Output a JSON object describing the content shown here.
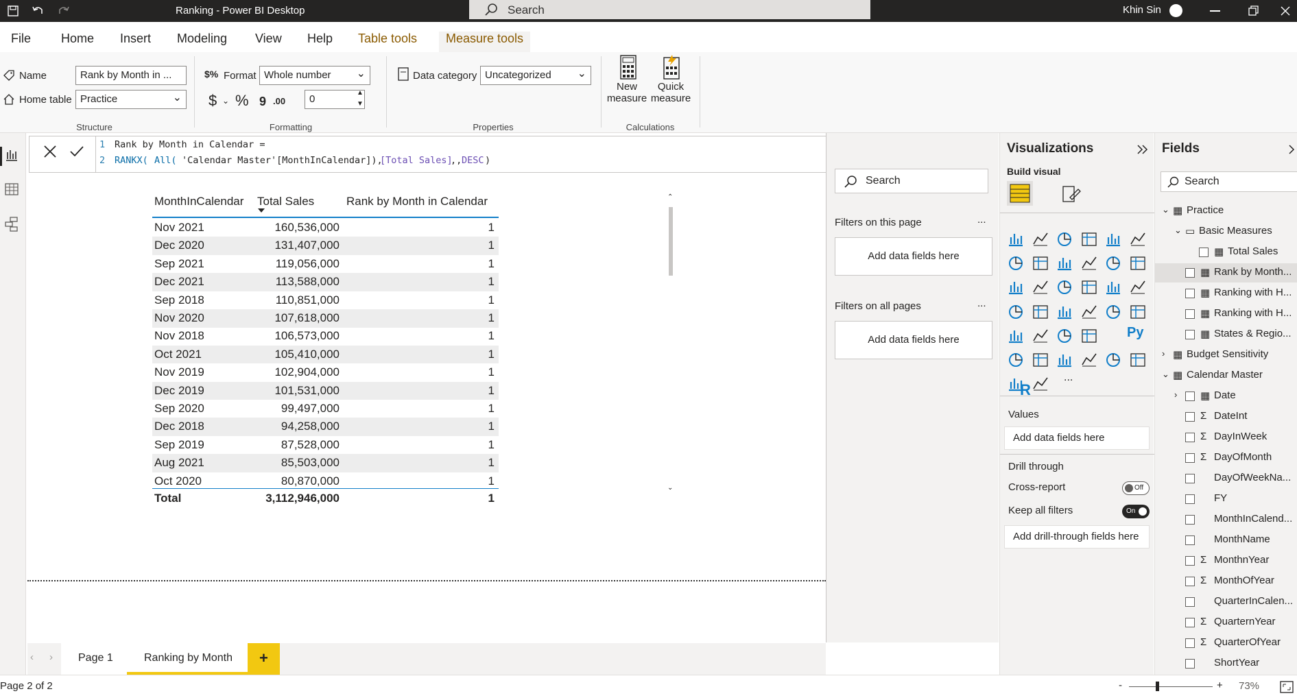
{
  "window": {
    "title": "Ranking - Power BI Desktop",
    "search_placeholder": "Search",
    "user": "Khin Sin"
  },
  "ribbon_tabs": [
    "File",
    "Home",
    "Insert",
    "Modeling",
    "View",
    "Help",
    "Table tools",
    "Measure tools"
  ],
  "structure": {
    "name_label": "Name",
    "name_value": "Rank by Month in ...",
    "home_table_label": "Home table",
    "home_table_value": "Practice",
    "group": "Structure"
  },
  "formatting": {
    "format_label": "Format",
    "format_value": "Whole number",
    "decimals": "0",
    "currency": "$",
    "percent": "%",
    "comma": "9",
    "dec_glyph": ".00",
    "group": "Formatting"
  },
  "properties": {
    "data_category_label": "Data category",
    "data_category_value": "Uncategorized",
    "group": "Properties"
  },
  "calculations": {
    "new1": "New",
    "new2": "measure",
    "quick1": "Quick",
    "quick2": "measure",
    "group": "Calculations"
  },
  "formula": {
    "ln1": "1",
    "line1": "Rank by Month in Calendar =",
    "ln2": "2",
    "l2a": "RANKX(",
    "l2b": "All(",
    "l2c": "'Calendar Master'[MonthInCalendar]),",
    "l2d": "[Total Sales]",
    ",,": ",,",
    "l2e": "DESC",
    ")": ")"
  },
  "table": {
    "headers": [
      "MonthInCalendar",
      "Total Sales",
      "Rank by Month in Calendar"
    ],
    "rows": [
      [
        "Nov 2021",
        "160,536,000",
        "1"
      ],
      [
        "Dec 2020",
        "131,407,000",
        "1"
      ],
      [
        "Sep 2021",
        "119,056,000",
        "1"
      ],
      [
        "Dec 2021",
        "113,588,000",
        "1"
      ],
      [
        "Sep 2018",
        "110,851,000",
        "1"
      ],
      [
        "Nov 2020",
        "107,618,000",
        "1"
      ],
      [
        "Nov 2018",
        "106,573,000",
        "1"
      ],
      [
        "Oct 2021",
        "105,410,000",
        "1"
      ],
      [
        "Nov 2019",
        "102,904,000",
        "1"
      ],
      [
        "Dec 2019",
        "101,531,000",
        "1"
      ],
      [
        "Sep 2020",
        "99,497,000",
        "1"
      ],
      [
        "Dec 2018",
        "94,258,000",
        "1"
      ],
      [
        "Sep 2019",
        "87,528,000",
        "1"
      ],
      [
        "Aug 2021",
        "85,503,000",
        "1"
      ],
      [
        "Oct 2020",
        "80,870,000",
        "1"
      ]
    ],
    "total": [
      "Total",
      "3,112,946,000",
      "1"
    ]
  },
  "filters": {
    "search": "Search",
    "on_page": "Filters on this page",
    "on_all": "Filters on all pages",
    "add": "Add data fields here",
    "more": "..."
  },
  "viz": {
    "title": "Visualizations",
    "build": "Build visual",
    "values": "Values",
    "add_values": "Add data fields here",
    "drill": "Drill through",
    "cross": "Cross-report",
    "cross_state": "Off",
    "keep": "Keep all filters",
    "keep_state": "On",
    "add_drill": "Add drill-through fields here",
    "r": "R",
    "py": "Py",
    "more": "..."
  },
  "fields": {
    "title": "Fields",
    "search": "Search",
    "items": [
      "Practice",
      "Basic Measures",
      "Total Sales",
      "Rank by Month...",
      "Ranking with H...",
      "Ranking with H...",
      "States & Regio...",
      "Budget Sensitivity",
      "Calendar Master",
      "Date",
      "DateInt",
      "DayInWeek",
      "DayOfMonth",
      "DayOfWeekNa...",
      "FY",
      "MonthInCalend...",
      "MonthName",
      "MonthnYear",
      "MonthOfYear",
      "QuarterInCalen...",
      "QuarternYear",
      "QuarterOfYear",
      "ShortYear"
    ]
  },
  "pages": {
    "p1": "Page 1",
    "p2": "Ranking by Month",
    "add": "+"
  },
  "status": {
    "page": "Page 2 of 2",
    "zoom": "73%",
    "minus": "-",
    "plus": "+"
  },
  "colors": {
    "accent": "#f2c811",
    "dark": "#252423",
    "pane": "#f3f2f1"
  }
}
